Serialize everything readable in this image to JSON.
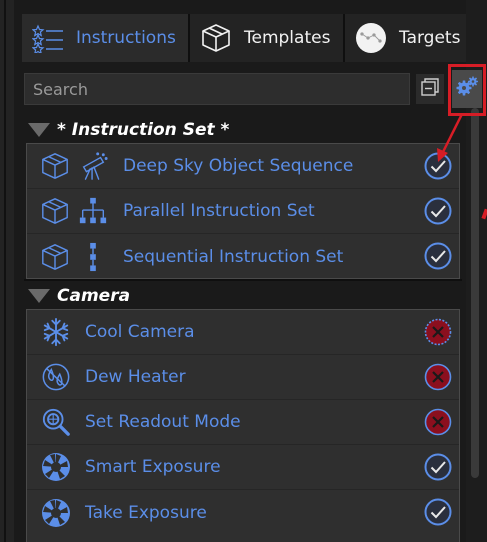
{
  "tabs": [
    {
      "label": "Instructions",
      "icon": "instructions-list-icon",
      "active": true
    },
    {
      "label": "Templates",
      "icon": "template-box-icon",
      "active": false
    },
    {
      "label": "Targets",
      "icon": "constellation-icon",
      "active": false
    }
  ],
  "search": {
    "placeholder": "Search",
    "value": ""
  },
  "toolbar": {
    "collapse_icon": "collapse-all-icon",
    "settings_icon": "gears-icon"
  },
  "groups": [
    {
      "title": "* Instruction Set *",
      "items": [
        {
          "label": "Deep Sky Object Sequence",
          "icon": "telescope-icon",
          "status": "ok"
        },
        {
          "label": "Parallel Instruction Set",
          "icon": "parallel-tree-icon",
          "status": "ok"
        },
        {
          "label": "Sequential Instruction Set",
          "icon": "sequential-chain-icon",
          "status": "ok"
        }
      ]
    },
    {
      "title": "Camera",
      "items": [
        {
          "label": "Cool Camera",
          "icon": "snowflake-icon",
          "status": "error"
        },
        {
          "label": "Dew Heater",
          "icon": "dew-drop-icon",
          "status": "error"
        },
        {
          "label": "Set Readout Mode",
          "icon": "readout-search-icon",
          "status": "error"
        },
        {
          "label": "Smart Exposure",
          "icon": "aperture-icon",
          "status": "ok"
        },
        {
          "label": "Take Exposure",
          "icon": "aperture-icon",
          "status": "ok"
        }
      ]
    }
  ],
  "colors": {
    "accent": "#5b8ee8",
    "error": "#8b0f1e",
    "highlight": "#d71d26",
    "panel": "#2f2f2f"
  }
}
